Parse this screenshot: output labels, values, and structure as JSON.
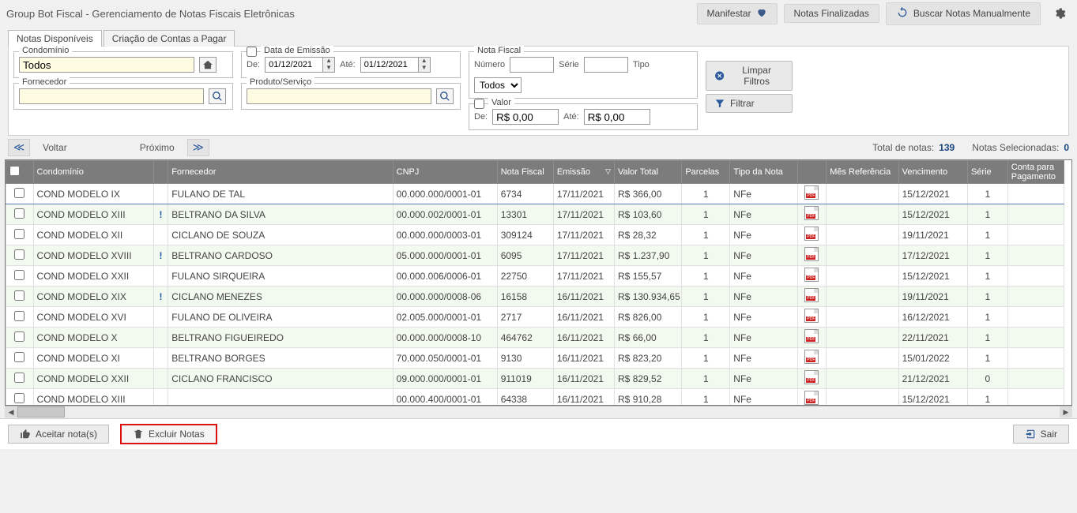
{
  "app_title": "Group Bot Fiscal - Gerenciamento de Notas Fiscais Eletrônicas",
  "header": {
    "manifestar": "Manifestar",
    "finalizadas": "Notas Finalizadas",
    "buscar": "Buscar Notas Manualmente"
  },
  "tabs": {
    "disponiveis": "Notas Disponíveis",
    "contas_pagar": "Criação de Contas a Pagar"
  },
  "filters": {
    "condominio_label": "Condomínio",
    "condominio_value": "Todos",
    "fornecedor_label": "Fornecedor",
    "fornecedor_value": "",
    "produto_label": "Produto/Serviço",
    "produto_value": "",
    "data_emissao_label": "Data de Emissão",
    "de_label": "De:",
    "ate_label": "Até:",
    "de_value": "01/12/2021",
    "ate_value": "01/12/2021",
    "nota_fiscal_legend": "Nota Fiscal",
    "numero_label": "Número",
    "numero_value": "",
    "serie_label": "Série",
    "serie_value": "",
    "tipo_label": "Tipo",
    "tipo_value": "Todos",
    "valor_label": "Valor",
    "valor_de": "R$ 0,00",
    "valor_ate": "R$ 0,00",
    "limpar": "Limpar Filtros",
    "filtrar": "Filtrar"
  },
  "nav": {
    "voltar": "Voltar",
    "proximo": "Próximo",
    "total_label": "Total de notas:",
    "total_value": "139",
    "sel_label": "Notas Selecionadas:",
    "sel_value": "0"
  },
  "columns": {
    "chk": "",
    "cond": "Condomínio",
    "alert": "",
    "forn": "Fornecedor",
    "cnpj": "CNPJ",
    "nota": "Nota Fiscal",
    "emissao": "Emissão",
    "valor": "Valor Total",
    "parcelas": "Parcelas",
    "tipo": "Tipo da Nota",
    "pdf": "",
    "mes": "Mês Referência",
    "venc": "Vencimento",
    "serie": "Série",
    "conta": "Conta para Pagamento"
  },
  "rows": [
    {
      "cond": "COND MODELO IX",
      "alert": "",
      "forn": "FULANO DE TAL",
      "cnpj": "00.000.000/0001-01",
      "nf": "6734",
      "emis": "17/11/2021",
      "valor": "R$ 366,00",
      "parc": "1",
      "tipo": "NFe",
      "mes": "",
      "venc": "15/12/2021",
      "serie": "1",
      "conta": ""
    },
    {
      "cond": "COND MODELO XIII",
      "alert": "!",
      "forn": "BELTRANO DA SILVA",
      "cnpj": "00.000.002/0001-01",
      "nf": "13301",
      "emis": "17/11/2021",
      "valor": "R$ 103,60",
      "parc": "1",
      "tipo": "NFe",
      "mes": "",
      "venc": "15/12/2021",
      "serie": "1",
      "conta": ""
    },
    {
      "cond": "COND MODELO XII",
      "alert": "",
      "forn": "CICLANO DE SOUZA",
      "cnpj": "00.000.000/0003-01",
      "nf": "309124",
      "emis": "17/11/2021",
      "valor": "R$ 28,32",
      "parc": "1",
      "tipo": "NFe",
      "mes": "",
      "venc": "19/11/2021",
      "serie": "1",
      "conta": ""
    },
    {
      "cond": "COND MODELO XVIII",
      "alert": "!",
      "forn": "BELTRANO CARDOSO",
      "cnpj": "05.000.000/0001-01",
      "nf": "6095",
      "emis": "17/11/2021",
      "valor": "R$ 1.237,90",
      "parc": "1",
      "tipo": "NFe",
      "mes": "",
      "venc": "17/12/2021",
      "serie": "1",
      "conta": ""
    },
    {
      "cond": "COND MODELO XXII",
      "alert": "",
      "forn": "FULANO SIRQUEIRA",
      "cnpj": "00.000.006/0006-01",
      "nf": "22750",
      "emis": "17/11/2021",
      "valor": "R$ 155,57",
      "parc": "1",
      "tipo": "NFe",
      "mes": "",
      "venc": "15/12/2021",
      "serie": "1",
      "conta": ""
    },
    {
      "cond": "COND MODELO XIX",
      "alert": "!",
      "forn": "CICLANO MENEZES",
      "cnpj": "00.000.000/0008-06",
      "nf": "16158",
      "emis": "16/11/2021",
      "valor": "R$ 130.934,65",
      "parc": "1",
      "tipo": "NFe",
      "mes": "",
      "venc": "19/11/2021",
      "serie": "1",
      "conta": ""
    },
    {
      "cond": "COND MODELO XVI",
      "alert": "",
      "forn": "FULANO DE OLIVEIRA",
      "cnpj": "02.005.000/0001-01",
      "nf": "2717",
      "emis": "16/11/2021",
      "valor": "R$ 826,00",
      "parc": "1",
      "tipo": "NFe",
      "mes": "",
      "venc": "16/12/2021",
      "serie": "1",
      "conta": ""
    },
    {
      "cond": "COND MODELO X",
      "alert": "",
      "forn": "BELTRANO FIGUEIREDO",
      "cnpj": "00.000.000/0008-10",
      "nf": "464762",
      "emis": "16/11/2021",
      "valor": "R$ 66,00",
      "parc": "1",
      "tipo": "NFe",
      "mes": "",
      "venc": "22/11/2021",
      "serie": "1",
      "conta": ""
    },
    {
      "cond": "COND MODELO XI",
      "alert": "",
      "forn": "BELTRANO BORGES",
      "cnpj": "70.000.050/0001-01",
      "nf": "9130",
      "emis": "16/11/2021",
      "valor": "R$ 823,20",
      "parc": "1",
      "tipo": "NFe",
      "mes": "",
      "venc": "15/01/2022",
      "serie": "1",
      "conta": ""
    },
    {
      "cond": "COND MODELO XXII",
      "alert": "",
      "forn": "CICLANO FRANCISCO",
      "cnpj": "09.000.000/0001-01",
      "nf": "911019",
      "emis": "16/11/2021",
      "valor": "R$ 829,52",
      "parc": "1",
      "tipo": "NFe",
      "mes": "",
      "venc": "21/12/2021",
      "serie": "0",
      "conta": ""
    },
    {
      "cond": "COND MODELO XIII",
      "alert": "",
      "forn": "",
      "cnpj": "00.000.400/0001-01",
      "nf": "64338",
      "emis": "16/11/2021",
      "valor": "R$ 910,28",
      "parc": "1",
      "tipo": "NFe",
      "mes": "",
      "venc": "15/12/2021",
      "serie": "1",
      "conta": ""
    }
  ],
  "footer": {
    "aceitar": "Aceitar nota(s)",
    "excluir": "Excluir Notas",
    "sair": "Sair"
  }
}
